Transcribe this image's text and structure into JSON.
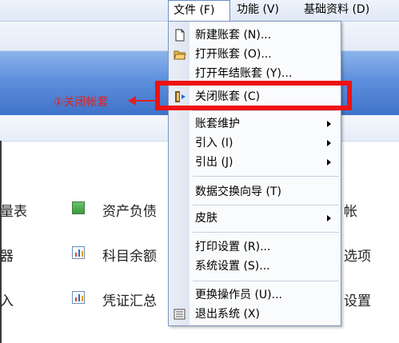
{
  "menubar": {
    "items": [
      {
        "label": "文件 (F)",
        "active": true
      },
      {
        "label": "功能 (V)",
        "active": false
      },
      {
        "label": "基础资料 (D)",
        "active": false
      }
    ]
  },
  "background_list": [
    {
      "left_text": "量表",
      "icon": "sheet-icon",
      "main_text": "资产负债",
      "right_text": "帐"
    },
    {
      "left_text": "器",
      "icon": "chart-icon",
      "main_text": "科目余额",
      "right_text": "选项"
    },
    {
      "left_text": "入",
      "icon": "chart-icon",
      "main_text": "凭证汇总",
      "right_text": "设置"
    }
  ],
  "annotation": {
    "label": "①关闭帐套"
  },
  "file_menu": {
    "items": [
      {
        "label": "新建账套 (N)...",
        "icon": "new-file-icon"
      },
      {
        "label": "打开账套 (O)...",
        "icon": "open-folder-icon"
      },
      {
        "label": "打开年结账套 (Y)...",
        "icon": ""
      },
      {
        "label": "关闭账套 (C)",
        "icon": "close-account-icon"
      },
      {
        "label": "账套维护",
        "submenu": true
      },
      {
        "label": "引入 (I)",
        "submenu": true
      },
      {
        "label": "引出 (J)",
        "submenu": true
      },
      {
        "label": "数据交换向导 (T)"
      },
      {
        "label": "皮肤",
        "submenu": true
      },
      {
        "label": "打印设置 (R)..."
      },
      {
        "label": "系统设置 (S)..."
      },
      {
        "label": "更换操作员 (U)..."
      },
      {
        "label": "退出系统 (X)",
        "icon": "exit-icon"
      }
    ]
  },
  "colors": {
    "highlight": "#ee1111",
    "toolbar_blue": "#5d8fdc",
    "annotation": "#e02020"
  }
}
